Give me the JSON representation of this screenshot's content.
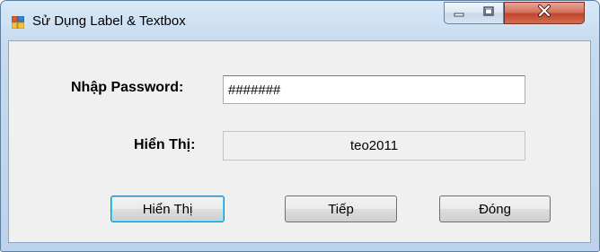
{
  "window": {
    "title": "Sử Dụng Label & Textbox",
    "icon": "winforms-app-icon",
    "controls": {
      "minimize_icon": "minimize-icon",
      "maximize_icon": "maximize-icon",
      "close_icon": "close-icon"
    }
  },
  "form": {
    "password_label": "Nhập  Password:",
    "password_value": "#######",
    "display_label": "Hiển Thị:",
    "display_value": "teo2011"
  },
  "buttons": {
    "show_label": "Hiển Thị",
    "next_label": "Tiếp",
    "close_label": "Đóng"
  },
  "colors": {
    "titlebar": "#c6dbf0",
    "close_button": "#c1452c",
    "client_background": "#f0f0f0"
  }
}
